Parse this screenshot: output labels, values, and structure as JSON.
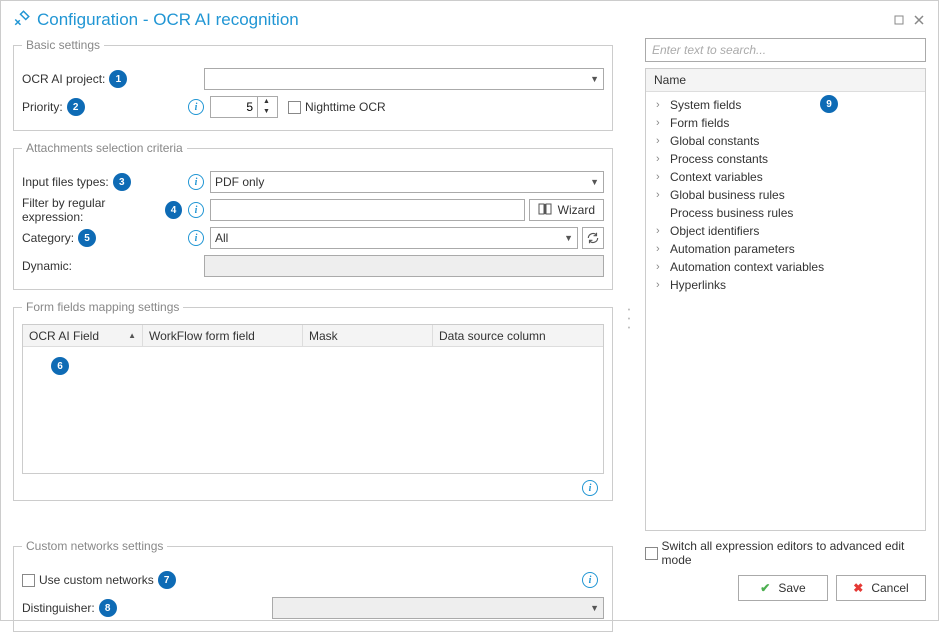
{
  "title": "Configuration - OCR AI recognition",
  "badges": [
    "1",
    "2",
    "3",
    "4",
    "5",
    "6",
    "7",
    "8",
    "9"
  ],
  "basic": {
    "legend": "Basic settings",
    "project_label": "OCR AI project:",
    "priority_label": "Priority:",
    "priority_value": "5",
    "nighttime_label": "Nighttime OCR"
  },
  "attach": {
    "legend": "Attachments selection criteria",
    "input_types_label": "Input files types:",
    "input_types_value": "PDF only",
    "regex_label": "Filter by regular expression:",
    "wizard_label": "Wizard",
    "category_label": "Category:",
    "category_value": "All",
    "dynamic_label": "Dynamic:"
  },
  "mapping": {
    "legend": "Form fields mapping settings",
    "col_ocr": "OCR AI Field",
    "col_wff": "WorkFlow form field",
    "col_mask": "Mask",
    "col_ds": "Data source column"
  },
  "custom": {
    "legend": "Custom networks settings",
    "use_label": "Use custom networks",
    "dist_label": "Distinguisher:"
  },
  "right": {
    "search_placeholder": "Enter text to search...",
    "name_header": "Name",
    "items": [
      {
        "label": "System fields",
        "expand": true
      },
      {
        "label": "Form fields",
        "expand": true
      },
      {
        "label": "Global constants",
        "expand": true
      },
      {
        "label": "Process constants",
        "expand": true
      },
      {
        "label": "Context variables",
        "expand": true
      },
      {
        "label": "Global business rules",
        "expand": true
      },
      {
        "label": "Process business rules",
        "expand": false
      },
      {
        "label": "Object identifiers",
        "expand": true
      },
      {
        "label": "Automation parameters",
        "expand": true
      },
      {
        "label": "Automation context variables",
        "expand": true
      },
      {
        "label": "Hyperlinks",
        "expand": true
      }
    ]
  },
  "footer": {
    "switch_label": "Switch all expression editors to advanced edit mode",
    "save": "Save",
    "cancel": "Cancel"
  }
}
